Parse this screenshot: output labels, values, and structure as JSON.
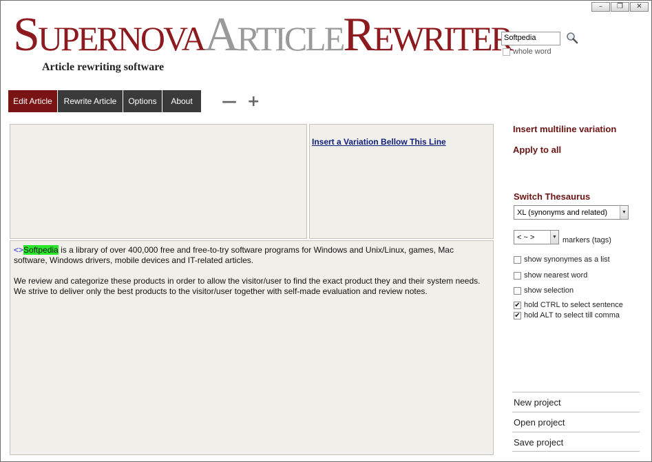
{
  "window": {
    "minimize_glyph": "–",
    "restore_glyph": "❐",
    "close_glyph": "✕"
  },
  "logo": {
    "s_cap": "S",
    "s_rest": "UPERNOVA",
    "a_cap": "A",
    "a_rest": "RTICLE",
    "r_cap": "R",
    "r_rest": "EWRITER",
    "subtitle": "Article rewriting software"
  },
  "search": {
    "value": "Softpedia",
    "whole_word_label": "whole word",
    "whole_word_checked": false
  },
  "nav": {
    "tabs": [
      {
        "label": "Edit Article",
        "active": true
      },
      {
        "label": "Rewrite Article",
        "active": false
      },
      {
        "label": "Options",
        "active": false
      },
      {
        "label": "About",
        "active": false
      }
    ],
    "zoom_out": "—",
    "zoom_in": "+"
  },
  "editor": {
    "insert_link": "Insert a Variation Bellow This Line",
    "article_marker": "<>",
    "article_highlight": "Softpedia",
    "paragraph1_rest": " is a library of over 400,000 free and free-to-try software programs for Windows and Unix/Linux, games, Mac software, Windows drivers, mobile devices and IT-related articles.",
    "paragraph2": "We review and categorize these products in order to allow the visitor/user to find the exact product they and their system needs. We strive to deliver only the best products to the visitor/user together with self-made evaluation and review notes."
  },
  "right_panel": {
    "insert_multiline": "Insert multiline variation",
    "apply_all": "Apply to all",
    "switch_thesaurus": "Switch Thesaurus",
    "thesaurus_value": "XL (synonyms and related)",
    "markers_value": "< ~ >",
    "markers_label": "markers (tags)",
    "options": [
      {
        "label": "show synonymes as a list",
        "checked": false
      },
      {
        "label": "show nearest word",
        "checked": false
      },
      {
        "label": "show selection",
        "checked": false
      },
      {
        "label": "hold CTRL to select sentence",
        "checked": true
      },
      {
        "label": "hold ALT   to select till comma",
        "checked": true
      }
    ],
    "check_glyph": "✔",
    "new_project": "New project",
    "open_project": "Open project",
    "save_project": "Save project"
  },
  "colors": {
    "brand": "#8c1a1e",
    "nav_active": "#7a1414",
    "nav_inactive": "#3a3a3a",
    "highlight": "#29e82b",
    "pane_bg": "#f1efe9"
  }
}
